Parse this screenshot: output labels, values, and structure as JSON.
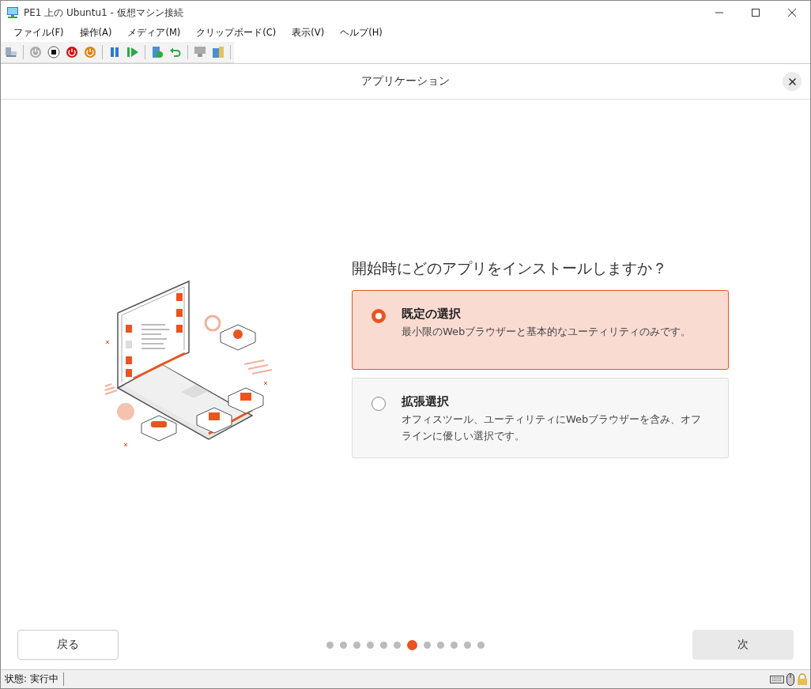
{
  "window": {
    "title": "PE1 上の Ubuntu1  - 仮想マシン接続"
  },
  "menu": [
    "ファイル(F)",
    "操作(A)",
    "メディア(M)",
    "クリップボード(C)",
    "表示(V)",
    "ヘルプ(H)"
  ],
  "dialog": {
    "title": "アプリケーション",
    "question": "開始時にどのアプリをインストールしますか？",
    "options": [
      {
        "title": "既定の選択",
        "description": "最小限のWebブラウザーと基本的なユーティリティのみです。",
        "selected": true
      },
      {
        "title": "拡張選択",
        "description": "オフィスツール、ユーティリティにWebブラウザーを含み、オフラインに優しい選択です。",
        "selected": false
      }
    ],
    "back_button": "戻る",
    "next_button": "次",
    "pager": [
      {
        "selected": false
      },
      {
        "selected": false
      },
      {
        "selected": false
      },
      {
        "selected": false
      },
      {
        "selected": false
      },
      {
        "selected": false
      },
      {
        "selected": true
      },
      {
        "selected": false
      },
      {
        "selected": false
      },
      {
        "selected": false
      },
      {
        "selected": false
      },
      {
        "selected": false
      }
    ]
  },
  "status_bar": {
    "text": "状態: 実行中"
  }
}
